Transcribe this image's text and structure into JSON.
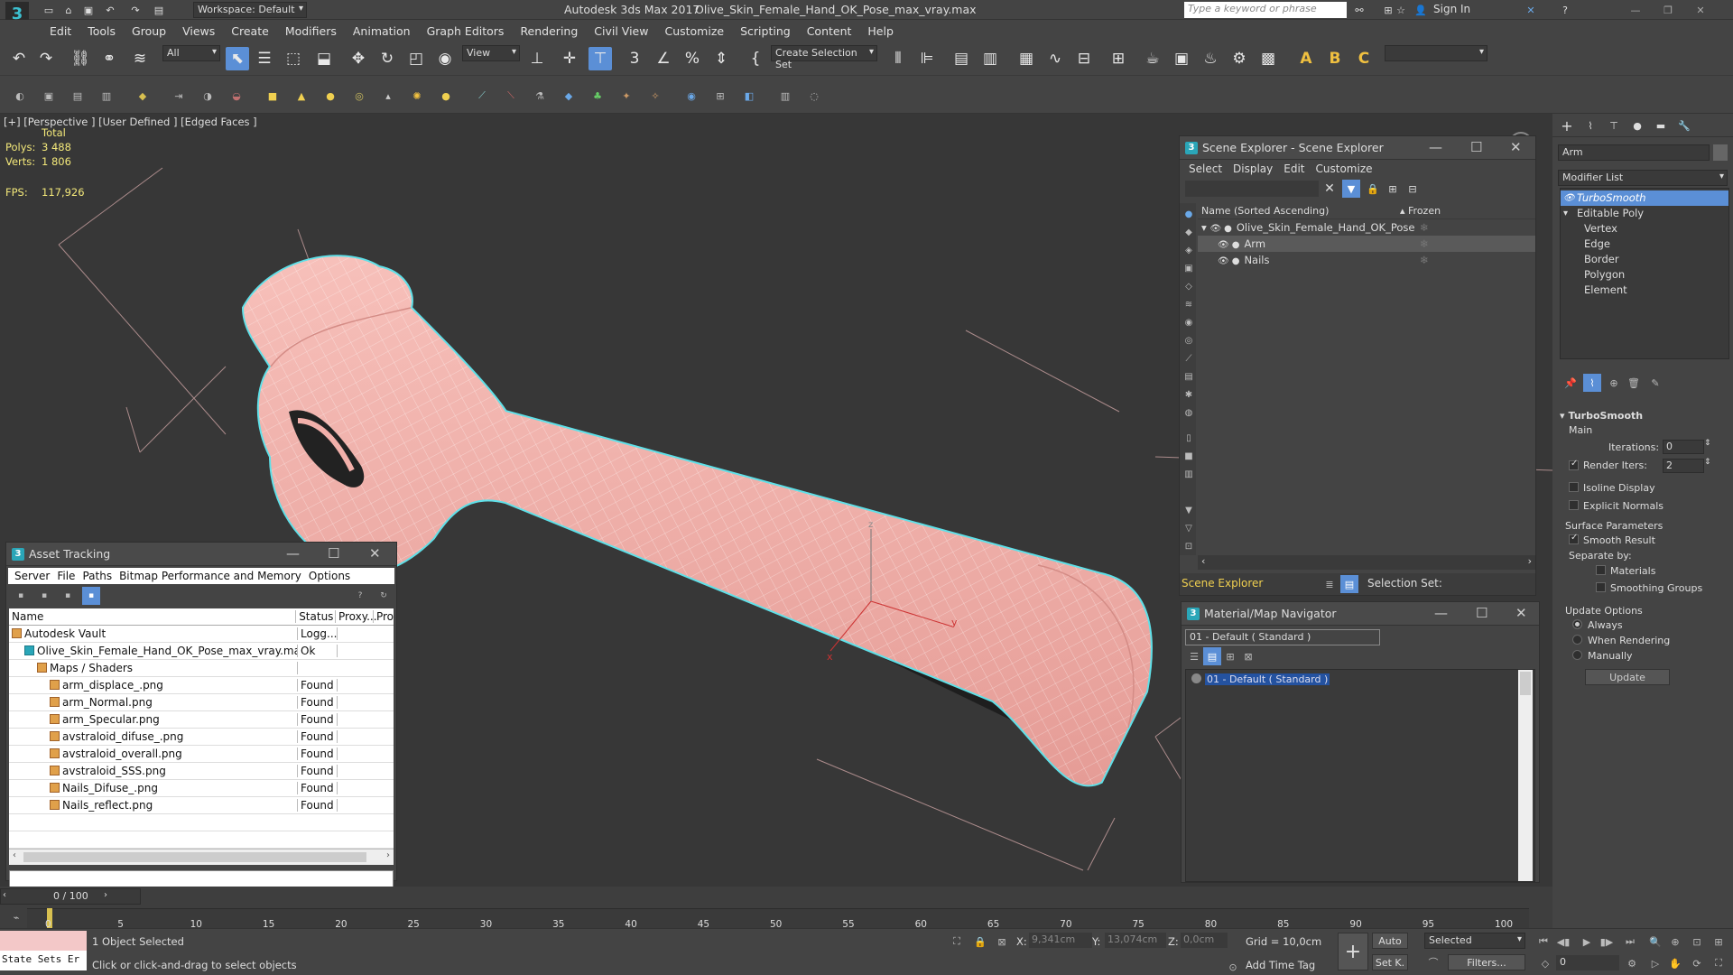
{
  "title": {
    "workspace": "Workspace: Default",
    "app": "Autodesk 3ds Max 2017",
    "file": "Olive_Skin_Female_Hand_OK_Pose_max_vray.max",
    "search_placeholder": "Type a keyword or phrase",
    "sign_in": "Sign In"
  },
  "menu": [
    "Edit",
    "Tools",
    "Group",
    "Views",
    "Create",
    "Modifiers",
    "Animation",
    "Graph Editors",
    "Rendering",
    "Civil View",
    "Customize",
    "Scripting",
    "Content",
    "Help"
  ],
  "toolbar": {
    "filter": "All",
    "view": "View",
    "selection_set": "Create Selection Set",
    "snaps": [
      "3",
      "%"
    ],
    "text_buttons": [
      "A",
      "B",
      "C"
    ]
  },
  "viewport": {
    "label": "[+] [Perspective ] [User Defined ] [Edged Faces ]",
    "total_label": "Total",
    "polys_label": "Polys:",
    "polys": "3 488",
    "verts_label": "Verts:",
    "verts": "1 806",
    "fps_label": "FPS:",
    "fps": "117,926",
    "axis_x": "x",
    "axis_y": "y",
    "axis_z": "z"
  },
  "asset_tracking": {
    "title": "Asset Tracking",
    "menu": [
      "Server",
      "File",
      "Paths",
      "Bitmap Performance and Memory",
      "Options"
    ],
    "columns": [
      "Name",
      "Status",
      "Proxy...",
      "Pro"
    ],
    "rows": [
      {
        "name": "Autodesk Vault",
        "status": "Logg...",
        "indent": 0,
        "icon": "vault"
      },
      {
        "name": "Olive_Skin_Female_Hand_OK_Pose_max_vray.max",
        "status": "Ok",
        "indent": 1,
        "icon": "max"
      },
      {
        "name": "Maps / Shaders",
        "status": "",
        "indent": 2,
        "icon": "folder"
      },
      {
        "name": "arm_displace_.png",
        "status": "Found",
        "indent": 3,
        "icon": "file"
      },
      {
        "name": "arm_Normal.png",
        "status": "Found",
        "indent": 3,
        "icon": "file"
      },
      {
        "name": "arm_Specular.png",
        "status": "Found",
        "indent": 3,
        "icon": "file"
      },
      {
        "name": "avstraloid_difuse_.png",
        "status": "Found",
        "indent": 3,
        "icon": "file"
      },
      {
        "name": "avstraloid_overall.png",
        "status": "Found",
        "indent": 3,
        "icon": "file"
      },
      {
        "name": "avstraloid_SSS.png",
        "status": "Found",
        "indent": 3,
        "icon": "file"
      },
      {
        "name": "Nails_Difuse_.png",
        "status": "Found",
        "indent": 3,
        "icon": "file"
      },
      {
        "name": "Nails_reflect.png",
        "status": "Found",
        "indent": 3,
        "icon": "file"
      }
    ]
  },
  "scene_explorer": {
    "title": "Scene Explorer - Scene Explorer",
    "menu": [
      "Select",
      "Display",
      "Edit",
      "Customize"
    ],
    "col_name": "Name (Sorted Ascending)",
    "col_frozen": "▴ Frozen",
    "items": [
      {
        "name": "Olive_Skin_Female_Hand_OK_Pose",
        "level": 0,
        "selected": false
      },
      {
        "name": "Arm",
        "level": 1,
        "selected": true
      },
      {
        "name": "Nails",
        "level": 1,
        "selected": false
      }
    ],
    "footer_label": "Scene Explorer",
    "selection_set_label": "Selection Set:"
  },
  "material_navigator": {
    "title": "Material/Map Navigator",
    "field": "01 - Default  ( Standard )",
    "item": "01 - Default  ( Standard )"
  },
  "modify_panel": {
    "object_name": "Arm",
    "modifier_list": "Modifier List",
    "stack": [
      {
        "label": "TurboSmooth",
        "level": 0,
        "selected": true
      },
      {
        "label": "Editable Poly",
        "level": 0,
        "selected": false
      },
      {
        "label": "Vertex",
        "level": 1,
        "selected": false
      },
      {
        "label": "Edge",
        "level": 1,
        "selected": false
      },
      {
        "label": "Border",
        "level": 1,
        "selected": false
      },
      {
        "label": "Polygon",
        "level": 1,
        "selected": false
      },
      {
        "label": "Element",
        "level": 1,
        "selected": false
      }
    ],
    "rollout_title": "TurboSmooth",
    "main_label": "Main",
    "iterations_label": "Iterations:",
    "iterations": "0",
    "render_iters_label": "Render Iters:",
    "render_iters": "2",
    "isoline_label": "Isoline Display",
    "explicit_normals_label": "Explicit Normals",
    "surface_params_label": "Surface Parameters",
    "smooth_result_label": "Smooth Result",
    "separate_by_label": "Separate by:",
    "materials_label": "Materials",
    "smoothing_groups_label": "Smoothing Groups",
    "update_options_label": "Update Options",
    "always_label": "Always",
    "when_rendering_label": "When Rendering",
    "manually_label": "Manually",
    "update_button": "Update"
  },
  "timeline": {
    "frame": "0 / 100",
    "ticks": [
      "0",
      "5",
      "10",
      "15",
      "20",
      "25",
      "30",
      "35",
      "40",
      "45",
      "50",
      "55",
      "60",
      "65",
      "70",
      "75",
      "80",
      "85",
      "90",
      "95",
      "100"
    ]
  },
  "status": {
    "maxscript": "State Sets Er",
    "selected": "1 Object Selected",
    "prompt": "Click or click-and-drag to select objects",
    "x_label": "X:",
    "x": "9,341cm",
    "y_label": "Y:",
    "y": "13,074cm",
    "z_label": "Z:",
    "z": "0,0cm",
    "grid": "Grid = 10,0cm",
    "add_time_tag": "Add Time Tag",
    "auto": "Auto",
    "set_k": "Set K.",
    "selected_dd": "Selected",
    "filters": "Filters...",
    "frame_field": "0"
  },
  "colors": {
    "accent": "#5b8fd6",
    "skin": "#f2b0aa",
    "selection_outline": "#5fe0e8",
    "viewport_bg": "#373737"
  }
}
